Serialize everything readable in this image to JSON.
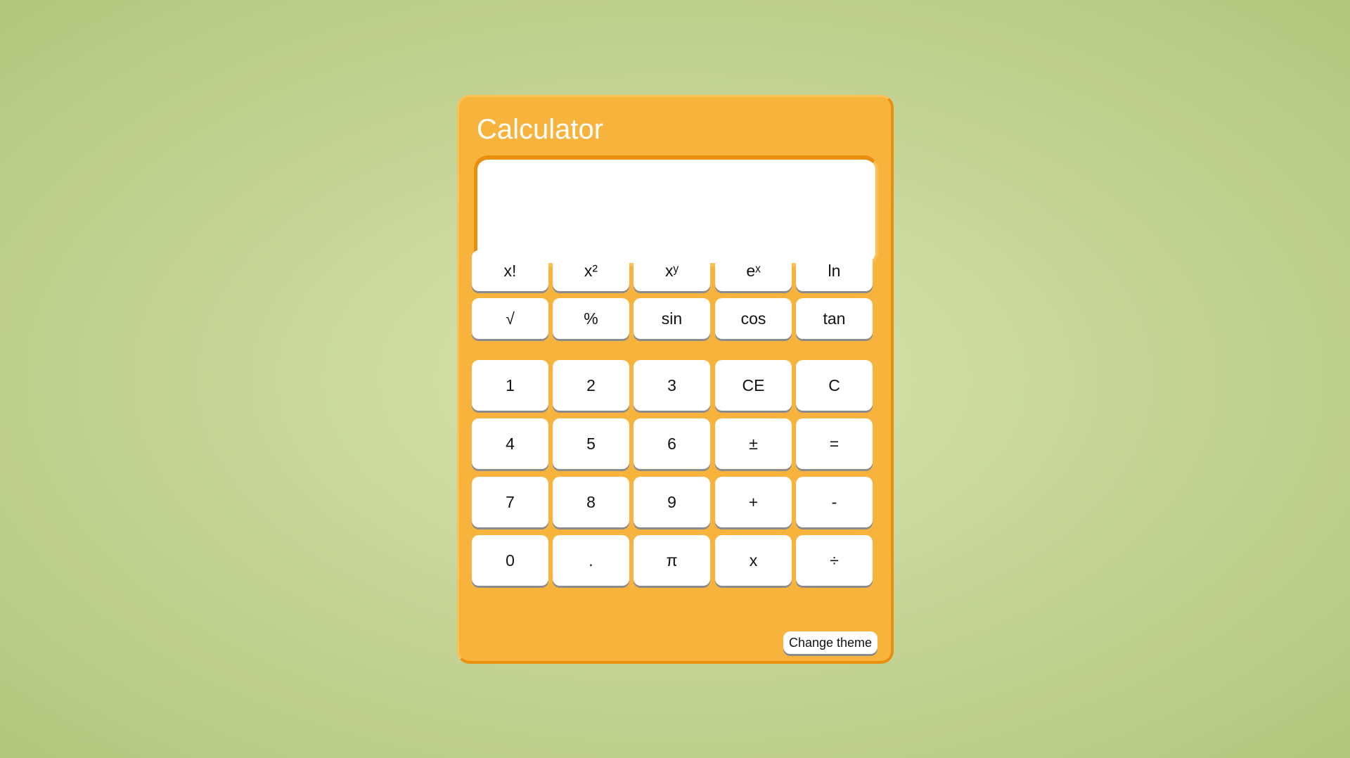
{
  "app": {
    "title": "Calculator",
    "display_value": ""
  },
  "function_keys": [
    [
      "x!",
      "x²",
      "xʸ",
      "eˣ",
      "ln"
    ],
    [
      "√",
      "%",
      "sin",
      "cos",
      "tan"
    ]
  ],
  "number_keys": [
    [
      "1",
      "2",
      "3",
      "CE",
      "C"
    ],
    [
      "4",
      "5",
      "6",
      "±",
      "="
    ],
    [
      "7",
      "8",
      "9",
      "+",
      "-"
    ],
    [
      "0",
      ".",
      "π",
      "x",
      "÷"
    ]
  ],
  "theme_button_label": "Change theme",
  "colors": {
    "background": "#c7d698",
    "calculator_body": "#f7b33b",
    "body_dark_edge": "#e98f10",
    "key_face": "#ffffff",
    "key_shadow": "#8c8c8c"
  }
}
